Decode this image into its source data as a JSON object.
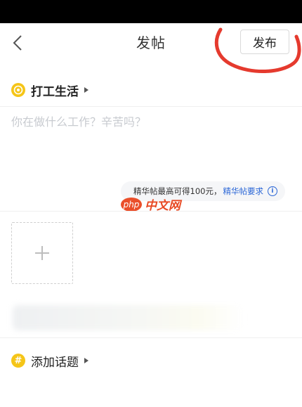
{
  "header": {
    "title": "发帖",
    "publish_label": "发布",
    "back_icon": "chevron-left-icon"
  },
  "category": {
    "label": "打工生活",
    "icon": "target-icon",
    "icon_color": "#f5c518"
  },
  "post": {
    "placeholder": "你在做什么工作？辛苦吗？",
    "value": ""
  },
  "tip": {
    "text": "精华帖最高可得100元，",
    "link": "精华帖要求",
    "link_color": "#2a66d6",
    "icon": "info-icon"
  },
  "watermark": {
    "badge": "php",
    "text": "中文网"
  },
  "upload": {
    "icon": "plus-icon"
  },
  "topic": {
    "label": "添加话题",
    "icon_glyph": "#",
    "icon_color": "#f5c518"
  },
  "annotation": {
    "color": "#e53a2e"
  }
}
